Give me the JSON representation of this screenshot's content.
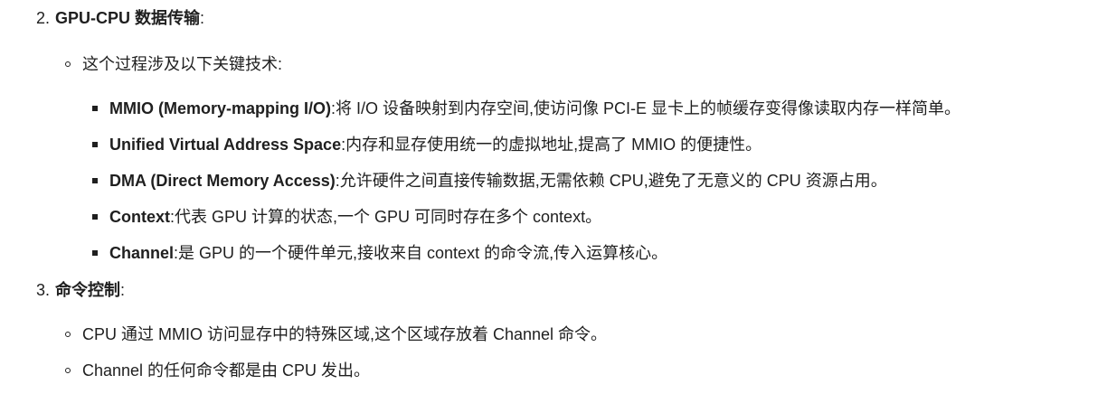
{
  "section2": {
    "number": "2.",
    "title": "GPU-CPU 数据传输",
    "colon": ":",
    "intro": "这个过程涉及以下关键技术:",
    "items": [
      {
        "term": "MMIO (Memory-mapping I/O)",
        "colon": ":",
        "desc": "将 I/O 设备映射到内存空间,使访问像 PCI-E 显卡上的帧缓存变得像读取内存一样简单。"
      },
      {
        "term": "Unified Virtual Address Space",
        "colon": ":",
        "desc": "内存和显存使用统一的虚拟地址,提高了 MMIO 的便捷性。"
      },
      {
        "term": "DMA (Direct Memory Access)",
        "colon": ":",
        "desc": "允许硬件之间直接传输数据,无需依赖 CPU,避免了无意义的 CPU 资源占用。"
      },
      {
        "term": "Context",
        "colon": ":",
        "desc": "代表 GPU 计算的状态,一个 GPU 可同时存在多个 context。"
      },
      {
        "term": "Channel",
        "colon": ":",
        "desc": "是 GPU 的一个硬件单元,接收来自 context 的命令流,传入运算核心。"
      }
    ]
  },
  "section3": {
    "number": "3.",
    "title": "命令控制",
    "colon": ":",
    "items": [
      "CPU 通过 MMIO 访问显存中的特殊区域,这个区域存放着 Channel 命令。",
      "Channel 的任何命令都是由 CPU 发出。"
    ]
  }
}
